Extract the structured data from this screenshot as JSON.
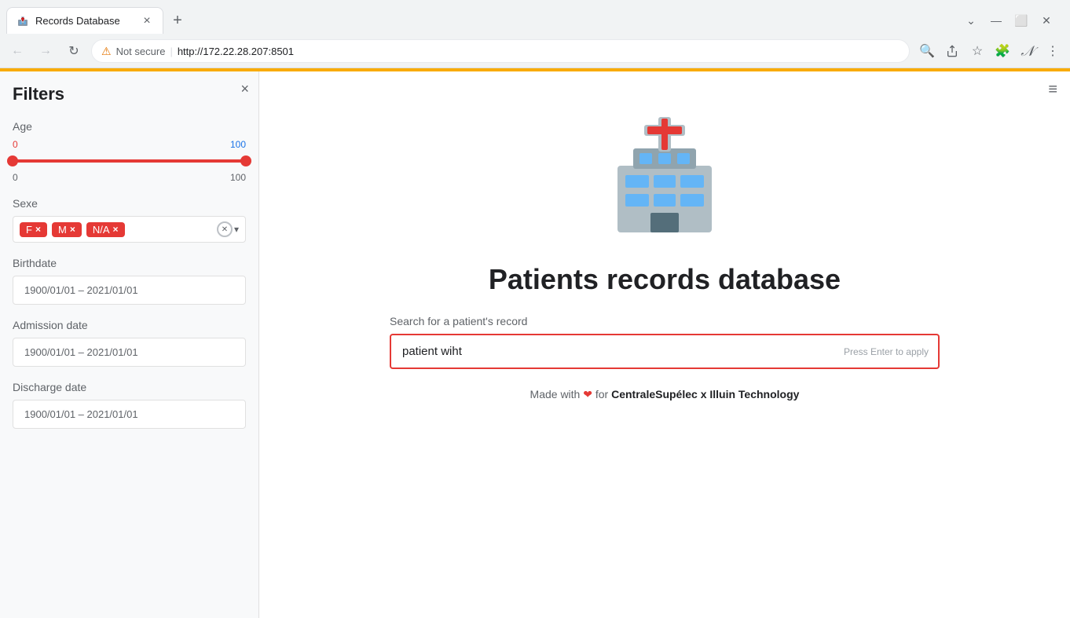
{
  "browser": {
    "tab_title": "Records Database",
    "tab_close": "×",
    "tab_new": "+",
    "window_minimize": "—",
    "window_maximize": "⬜",
    "window_close": "✕",
    "window_chevron": "⌄",
    "nav_back": "←",
    "nav_forward": "→",
    "nav_reload": "↻",
    "address_warning": "⚠",
    "address_separator": "|",
    "address_url": "http://172.22.28.207:8501",
    "address_not_secure": "Not secure",
    "toolbar_search": "🔍",
    "toolbar_share": "↗",
    "toolbar_bookmark": "☆",
    "toolbar_extensions": "🧩",
    "toolbar_profile": "𝒩",
    "toolbar_menu": "⋮"
  },
  "sidebar": {
    "close_icon": "×",
    "title": "Filters",
    "age": {
      "label": "Age",
      "min_display": "0",
      "max_display": "100",
      "min_val": 0,
      "max_val": 100,
      "range_min": "0",
      "range_max": "100"
    },
    "sexe": {
      "label": "Sexe",
      "badges": [
        {
          "text": "F",
          "close": "×"
        },
        {
          "text": "M",
          "close": "×"
        },
        {
          "text": "N/A",
          "close": "×"
        }
      ]
    },
    "birthdate": {
      "label": "Birthdate",
      "range": "1900/01/01 – 2021/01/01"
    },
    "admission_date": {
      "label": "Admission date",
      "range": "1900/01/01 – 2021/01/01"
    },
    "discharge_date": {
      "label": "Discharge date",
      "range": "1900/01/01 – 2021/01/01"
    }
  },
  "main": {
    "hamburger": "≡",
    "page_title": "Patients records database",
    "search_label": "Search for a patient's record",
    "search_value": "patient wiht",
    "search_placeholder": "",
    "search_hint": "Press Enter to apply",
    "footer_text_1": "Made with",
    "footer_heart": "❤",
    "footer_text_2": "for",
    "footer_brand": "CentraleSupélec x Illuin Technology"
  }
}
